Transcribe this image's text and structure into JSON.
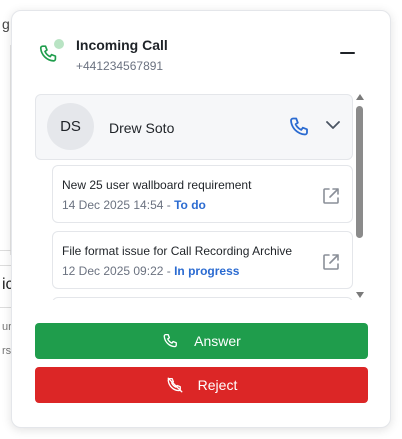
{
  "background": {
    "fragment_g": "g",
    "fragment_ic": "ic",
    "fragment_ur": "ur:",
    "fragment_rs": "rs"
  },
  "colors": {
    "answer": "#1f9d4c",
    "reject": "#dc2626",
    "status_link": "#2b6bd1",
    "call_icon": "#1f9d4c",
    "contact_phone_icon": "#2b6bd1"
  },
  "header": {
    "title": "Incoming Call",
    "number": "+441234567891",
    "icon": "phone-icon",
    "minimize_icon": "minimize-icon"
  },
  "contact": {
    "initials": "DS",
    "name": "Drew Soto",
    "call_icon": "phone-icon",
    "expand_icon": "chevron-down-icon"
  },
  "tickets": [
    {
      "title": "New 25 user wallboard requirement",
      "date": "14 Dec 2025 14:54",
      "separator": " - ",
      "status": "To do",
      "icon": "external-link-icon"
    },
    {
      "title": "File format issue for Call Recording Archive",
      "date": "12 Dec 2025 09:22",
      "separator": " - ",
      "status": "In progress",
      "icon": "external-link-icon"
    }
  ],
  "actions": {
    "answer_label": "Answer",
    "reject_label": "Reject",
    "answer_icon": "phone-icon",
    "reject_icon": "phone-off-icon"
  }
}
